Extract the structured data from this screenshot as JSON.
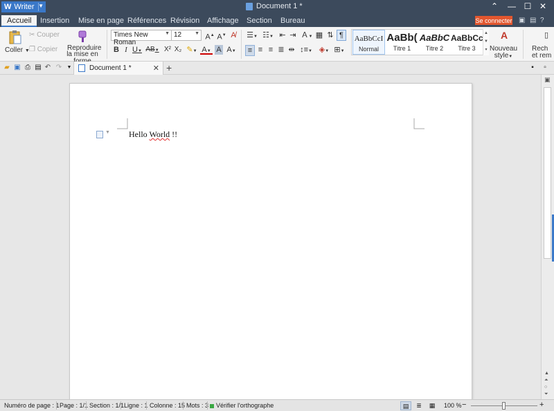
{
  "titlebar": {
    "app_name": "Writer",
    "app_logo": "W",
    "document_title": "Document 1 *",
    "controls": {
      "pin": "⌃",
      "minimize": "—",
      "maximize": "☐",
      "close": "✕"
    }
  },
  "tabs": {
    "items": [
      "Accueil",
      "Insertion",
      "Mise en page",
      "Références",
      "Révision",
      "Affichage",
      "Section",
      "Bureau"
    ],
    "signin": "Se connecter",
    "help": "?"
  },
  "ribbon": {
    "paste": "Coller",
    "cut": "Couper",
    "copy": "Copier",
    "format_painter_l1": "Reproduire",
    "format_painter_l2": "la mise en forme",
    "font_name": "Times New Roman",
    "font_size": "12",
    "styles": [
      {
        "preview": "AaBbCcI",
        "label": "Normal"
      },
      {
        "preview": "AaBb(",
        "label": "Titre 1"
      },
      {
        "preview": "AaBbC",
        "label": "Titre 2"
      },
      {
        "preview": "AaBbCc",
        "label": "Titre 3"
      }
    ],
    "new_style_l1": "Nouveau",
    "new_style_l2": "style",
    "find_l1": "Rech",
    "find_l2": "et rem"
  },
  "doctab": {
    "name": "Document 1 *"
  },
  "document": {
    "text_before": "Hello ",
    "text_squiggle": "World",
    "text_after": " !!"
  },
  "status": {
    "page_number": "Numéro de page : 1",
    "page": "Page : 1/1",
    "section": "Section : 1/1",
    "line": "Ligne : 1",
    "column": "Colonne : 15",
    "words": "Mots : 3",
    "spell": "Vérifier l'orthographe",
    "zoom": "100 %",
    "zoom_level_percent": 100
  },
  "colors": {
    "accent": "#3a78c8",
    "titlebar": "#3c4a5c",
    "signin": "#e2562e"
  }
}
